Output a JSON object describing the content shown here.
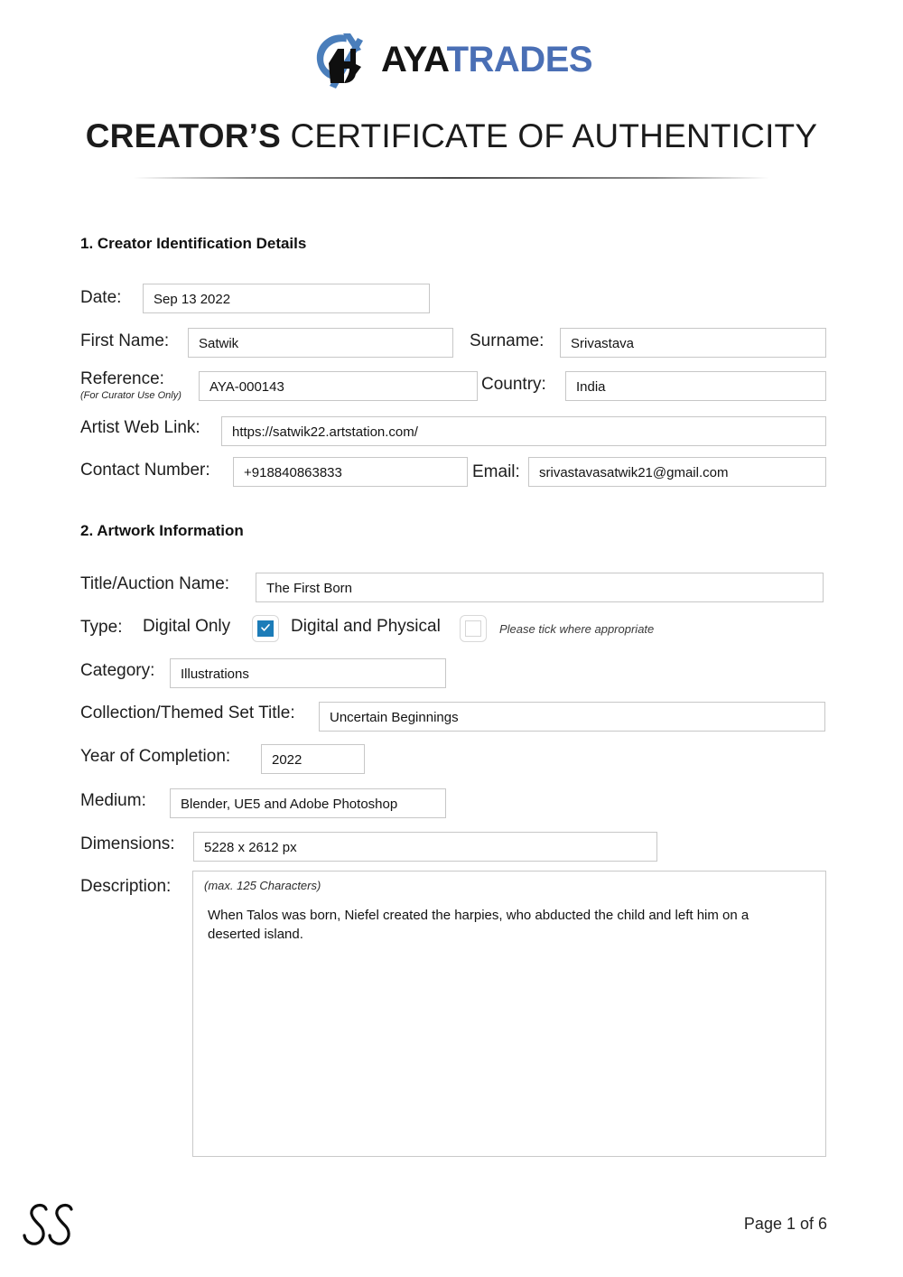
{
  "brand": {
    "name_part1": "AYA",
    "name_part2": "TRADES",
    "logo_icon": "aya-trades-logo",
    "accent_blue": "#4a6fb5",
    "checkbox_blue": "#1c7cb8"
  },
  "document": {
    "title_bold": "CREATOR’S",
    "title_rest": " CERTIFICATE OF AUTHENTICITY"
  },
  "section1": {
    "heading": "1. Creator Identification Details",
    "date": {
      "label": "Date:",
      "value": "Sep 13 2022"
    },
    "first_name": {
      "label": "First Name:",
      "value": "Satwik"
    },
    "surname": {
      "label": "Surname:",
      "value": "Srivastava"
    },
    "reference": {
      "label": "Reference:",
      "sublabel": "(For Curator Use Only)",
      "value": "AYA-000143"
    },
    "country": {
      "label": "Country:",
      "value": "India"
    },
    "web_link": {
      "label": "Artist Web Link:",
      "value": "https://satwik22.artstation.com/"
    },
    "contact_number": {
      "label": "Contact Number:",
      "value": "+918840863833"
    },
    "email": {
      "label": "Email:",
      "value": "srivastavasatwik21@gmail.com"
    }
  },
  "section2": {
    "heading": "2. Artwork Information",
    "title_auction": {
      "label": "Title/Auction Name:",
      "value": "The First Born"
    },
    "type": {
      "label": "Type:",
      "option_digital_only": "Digital Only",
      "option_digital_physical": "Digital and Physical",
      "digital_only_checked": true,
      "digital_physical_checked": false,
      "note": "Please tick where appropriate"
    },
    "category": {
      "label": "Category:",
      "value": "Illustrations"
    },
    "collection": {
      "label": "Collection/Themed Set Title:",
      "value": "Uncertain Beginnings"
    },
    "year": {
      "label": "Year of Completion:",
      "value": "2022"
    },
    "medium": {
      "label": "Medium:",
      "value": "Blender, UE5 and Adobe Photoshop"
    },
    "dimensions": {
      "label": "Dimensions:",
      "value": "5228 x 2612 px"
    },
    "description": {
      "label": "Description:",
      "hint": "(max. 125 Characters)",
      "value": "When Talos was born, Niefel created the harpies, who abducted the child and left him on a deserted island."
    }
  },
  "footer": {
    "signature_icon": "handwritten-signature",
    "page_number": "Page 1 of 6"
  }
}
